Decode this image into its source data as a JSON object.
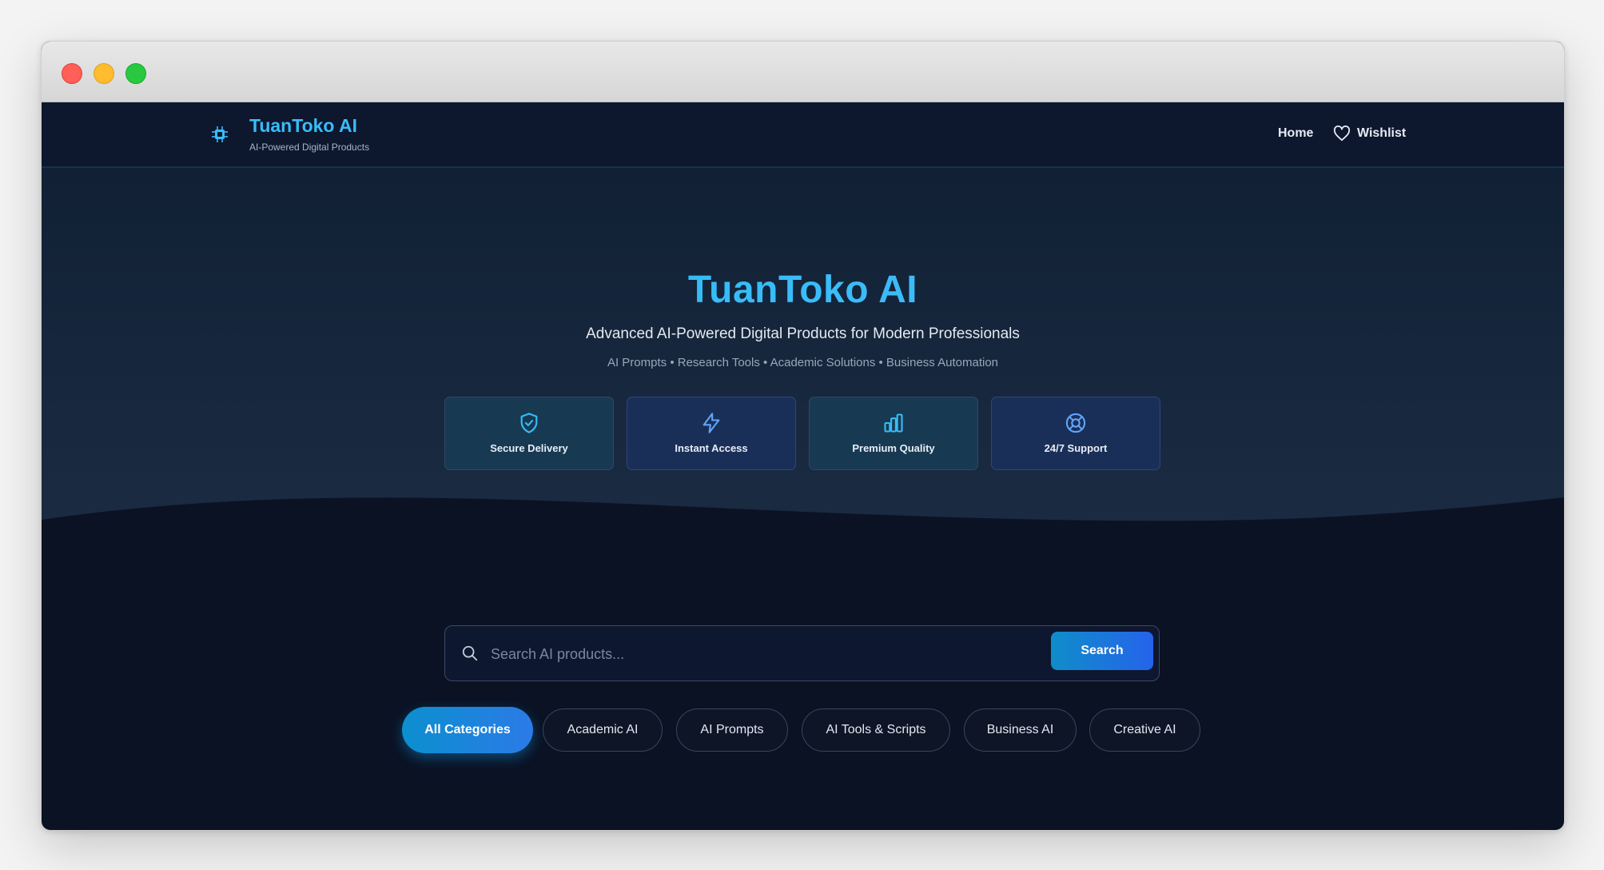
{
  "nav": {
    "brand_name": "TuanToko AI",
    "brand_tagline": "AI-Powered Digital Products",
    "home_label": "Home",
    "wishlist_label": "Wishlist"
  },
  "hero": {
    "title": "TuanToko AI",
    "subtitle": "Advanced AI-Powered Digital Products for Modern Professionals",
    "tags": "AI Prompts • Research Tools • Academic Solutions • Business Automation",
    "features": [
      {
        "label": "Secure Delivery",
        "icon": "shield-check-icon"
      },
      {
        "label": "Instant Access",
        "icon": "lightning-icon"
      },
      {
        "label": "Premium Quality",
        "icon": "bar-chart-icon"
      },
      {
        "label": "24/7 Support",
        "icon": "lifebuoy-icon"
      }
    ]
  },
  "search": {
    "placeholder": "Search AI products...",
    "button_label": "Search"
  },
  "categories": [
    {
      "label": "All Categories",
      "active": true
    },
    {
      "label": "Academic AI",
      "active": false
    },
    {
      "label": "AI Prompts",
      "active": false
    },
    {
      "label": "AI Tools & Scripts",
      "active": false
    },
    {
      "label": "Business AI",
      "active": false
    },
    {
      "label": "Creative AI",
      "active": false
    }
  ],
  "colors": {
    "accent": "#38bdf8",
    "button_gradient_start": "#0f8dc9",
    "button_gradient_end": "#2563eb",
    "page_background": "#0b1224"
  }
}
